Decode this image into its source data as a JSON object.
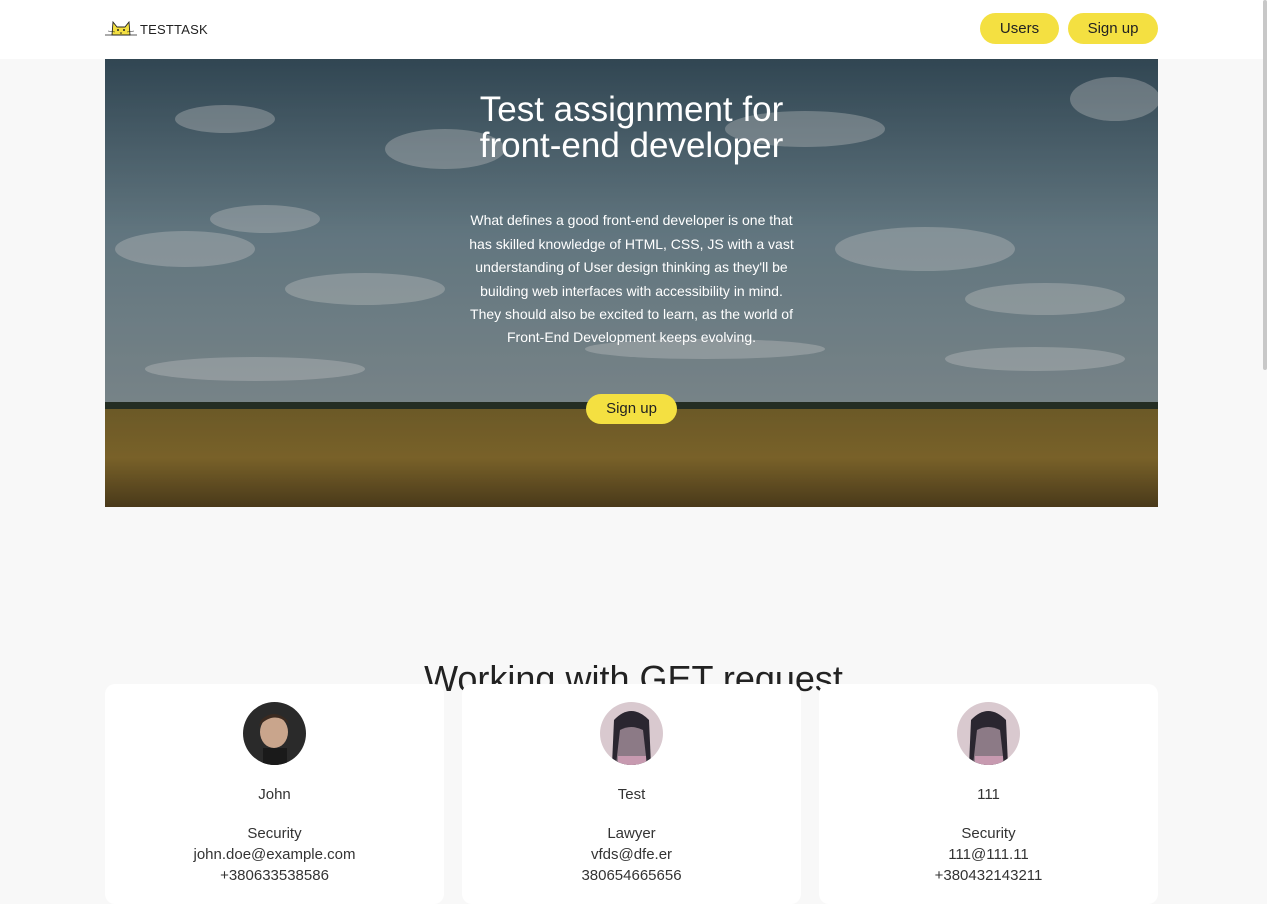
{
  "header": {
    "logo_text": "TESTTASK",
    "nav": {
      "users_label": "Users",
      "signup_label": "Sign up"
    }
  },
  "hero": {
    "title": "Test assignment for front-end developer",
    "text": "What defines a good front-end developer is one that has skilled knowledge of HTML, CSS, JS with a vast understanding of User design thinking as they'll be building web interfaces with accessibility in mind. They should also be excited to learn, as the world of Front-End Development keeps evolving.",
    "button_label": "Sign up"
  },
  "users_section": {
    "title": "Working with GET request",
    "cards": [
      {
        "name": "John",
        "position": "Security",
        "email": "john.doe@example.com",
        "phone": "+380633538586",
        "avatar": "male-photo"
      },
      {
        "name": "Test",
        "position": "Lawyer",
        "email": "vfds@dfe.er",
        "phone": "380654665656",
        "avatar": "chair-photo"
      },
      {
        "name": "111",
        "position": "Security",
        "email": "111@111.11",
        "phone": "+380432143211",
        "avatar": "chair-photo"
      }
    ]
  },
  "colors": {
    "accent": "#f4e041",
    "background": "#f8f8f8",
    "card": "#ffffff",
    "text": "#222222"
  }
}
